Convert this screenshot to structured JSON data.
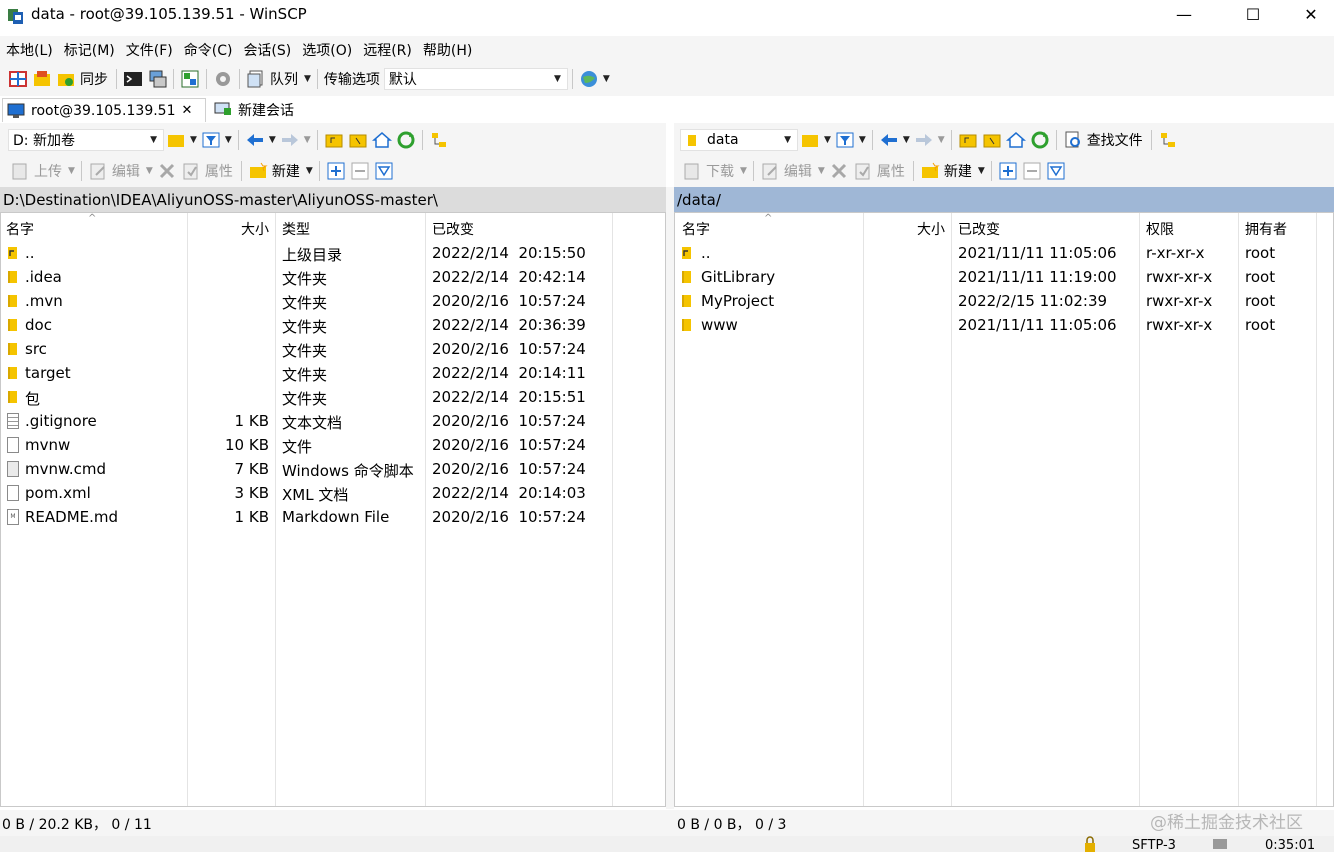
{
  "window": {
    "title": "data - root@39.105.139.51 - WinSCP",
    "minimize": "—",
    "maximize": "☐",
    "close": "✕"
  },
  "menu": [
    "本地(L)",
    "标记(M)",
    "文件(F)",
    "命令(C)",
    "会话(S)",
    "选项(O)",
    "远程(R)",
    "帮助(H)"
  ],
  "toolbar": {
    "sync_label": "同步",
    "queue_label": "队列",
    "transfer_options_label": "传输选项",
    "transfer_preset": "默认"
  },
  "tabs": {
    "session_label": "root@39.105.139.51",
    "close": "✕",
    "new_session_label": "新建会话"
  },
  "left": {
    "drive": "D: 新加卷",
    "upload_label": "上传",
    "edit_label": "编辑",
    "properties_label": "属性",
    "new_label": "新建",
    "path": "D:\\Destination\\IDEA\\AliyunOSS-master\\AliyunOSS-master\\",
    "columns": {
      "name": "名字",
      "size": "大小",
      "type": "类型",
      "changed": "已改变"
    },
    "files": [
      {
        "name": "..",
        "size": "",
        "type": "上级目录",
        "changed": "2022/2/14  20:15:50",
        "icon": "parent"
      },
      {
        "name": ".idea",
        "size": "",
        "type": "文件夹",
        "changed": "2022/2/14  20:42:14",
        "icon": "folder"
      },
      {
        "name": ".mvn",
        "size": "",
        "type": "文件夹",
        "changed": "2020/2/16  10:57:24",
        "icon": "folder"
      },
      {
        "name": "doc",
        "size": "",
        "type": "文件夹",
        "changed": "2022/2/14  20:36:39",
        "icon": "folder"
      },
      {
        "name": "src",
        "size": "",
        "type": "文件夹",
        "changed": "2020/2/16  10:57:24",
        "icon": "folder"
      },
      {
        "name": "target",
        "size": "",
        "type": "文件夹",
        "changed": "2022/2/14  20:14:11",
        "icon": "folder"
      },
      {
        "name": "包",
        "size": "",
        "type": "文件夹",
        "changed": "2022/2/14  20:15:51",
        "icon": "folder"
      },
      {
        "name": ".gitignore",
        "size": "1 KB",
        "type": "文本文档",
        "changed": "2020/2/16  10:57:24",
        "icon": "text"
      },
      {
        "name": "mvnw",
        "size": "10 KB",
        "type": "文件",
        "changed": "2020/2/16  10:57:24",
        "icon": "file"
      },
      {
        "name": "mvnw.cmd",
        "size": "7 KB",
        "type": "Windows 命令脚本",
        "changed": "2020/2/16  10:57:24",
        "icon": "cmd"
      },
      {
        "name": "pom.xml",
        "size": "3 KB",
        "type": "XML 文档",
        "changed": "2022/2/14  20:14:03",
        "icon": "file"
      },
      {
        "name": "README.md",
        "size": "1 KB",
        "type": "Markdown File",
        "changed": "2020/2/16  10:57:24",
        "icon": "md"
      }
    ],
    "status": "0 B / 20.2 KB，  0 / 11"
  },
  "right": {
    "dir": "data",
    "download_label": "下载",
    "edit_label": "编辑",
    "properties_label": "属性",
    "new_label": "新建",
    "find_files_label": "查找文件",
    "path": "/data/",
    "columns": {
      "name": "名字",
      "size": "大小",
      "changed": "已改变",
      "rights": "权限",
      "owner": "拥有者"
    },
    "files": [
      {
        "name": "..",
        "changed": "2021/11/11 11:05:06",
        "rights": "r-xr-xr-x",
        "owner": "root",
        "icon": "parent"
      },
      {
        "name": "GitLibrary",
        "changed": "2021/11/11 11:19:00",
        "rights": "rwxr-xr-x",
        "owner": "root",
        "icon": "folder"
      },
      {
        "name": "MyProject",
        "changed": "2022/2/15 11:02:39",
        "rights": "rwxr-xr-x",
        "owner": "root",
        "icon": "folder"
      },
      {
        "name": "www",
        "changed": "2021/11/11 11:05:06",
        "rights": "rwxr-xr-x",
        "owner": "root",
        "icon": "folder"
      }
    ],
    "status": "0 B / 0 B，  0 / 3"
  },
  "watermark": "@稀土掘金技术社区",
  "bottom": {
    "protocol": "SFTP-3",
    "time": "0:35:01"
  },
  "colors": {
    "folder": "#f5c400",
    "path_active": "#9fb7d6",
    "path_inactive": "#dcdcdc",
    "accent_blue": "#1f6fd1",
    "refresh_green": "#2ea02e"
  }
}
